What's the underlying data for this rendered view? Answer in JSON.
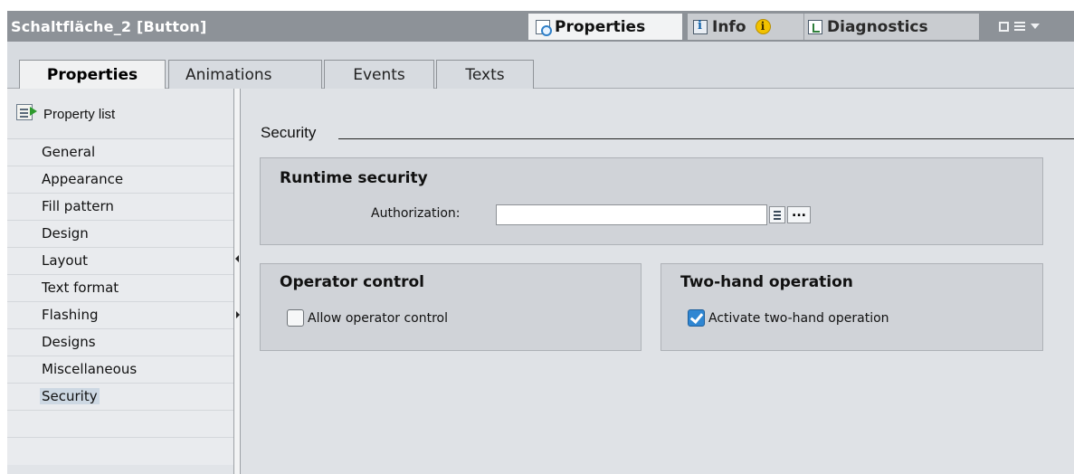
{
  "titlebar": {
    "title": "Schaltfläche_2 [Button]",
    "tabs": [
      {
        "label": "Properties",
        "icon": "properties-icon",
        "active": true
      },
      {
        "label": "Info",
        "icon": "info-icon",
        "badge": "i"
      },
      {
        "label": "Diagnostics",
        "icon": "diagnostics-icon"
      }
    ]
  },
  "subtabs": [
    {
      "label": "Properties",
      "active": true
    },
    {
      "label": "Animations"
    },
    {
      "label": "Events"
    },
    {
      "label": "Texts"
    }
  ],
  "nav": {
    "header": "Property list",
    "items": [
      {
        "label": "General"
      },
      {
        "label": "Appearance"
      },
      {
        "label": "Fill pattern"
      },
      {
        "label": "Design"
      },
      {
        "label": "Layout"
      },
      {
        "label": "Text format"
      },
      {
        "label": "Flashing"
      },
      {
        "label": "Designs"
      },
      {
        "label": "Miscellaneous"
      },
      {
        "label": "Security",
        "selected": true
      }
    ]
  },
  "content": {
    "section_title": "Security",
    "runtime": {
      "title": "Runtime security",
      "authorization_label": "Authorization:",
      "authorization_value": "",
      "browse_label": "..."
    },
    "operator": {
      "title": "Operator control",
      "checkbox_label": "Allow operator control",
      "checked": false
    },
    "twohand": {
      "title": "Two-hand operation",
      "checkbox_label": "Activate two-hand operation",
      "checked": true
    }
  },
  "colors": {
    "titlebar": "#8d9298",
    "panel": "#d7dbe0",
    "checkbox_checked": "#2f86d2",
    "info_badge": "#f2c200"
  }
}
